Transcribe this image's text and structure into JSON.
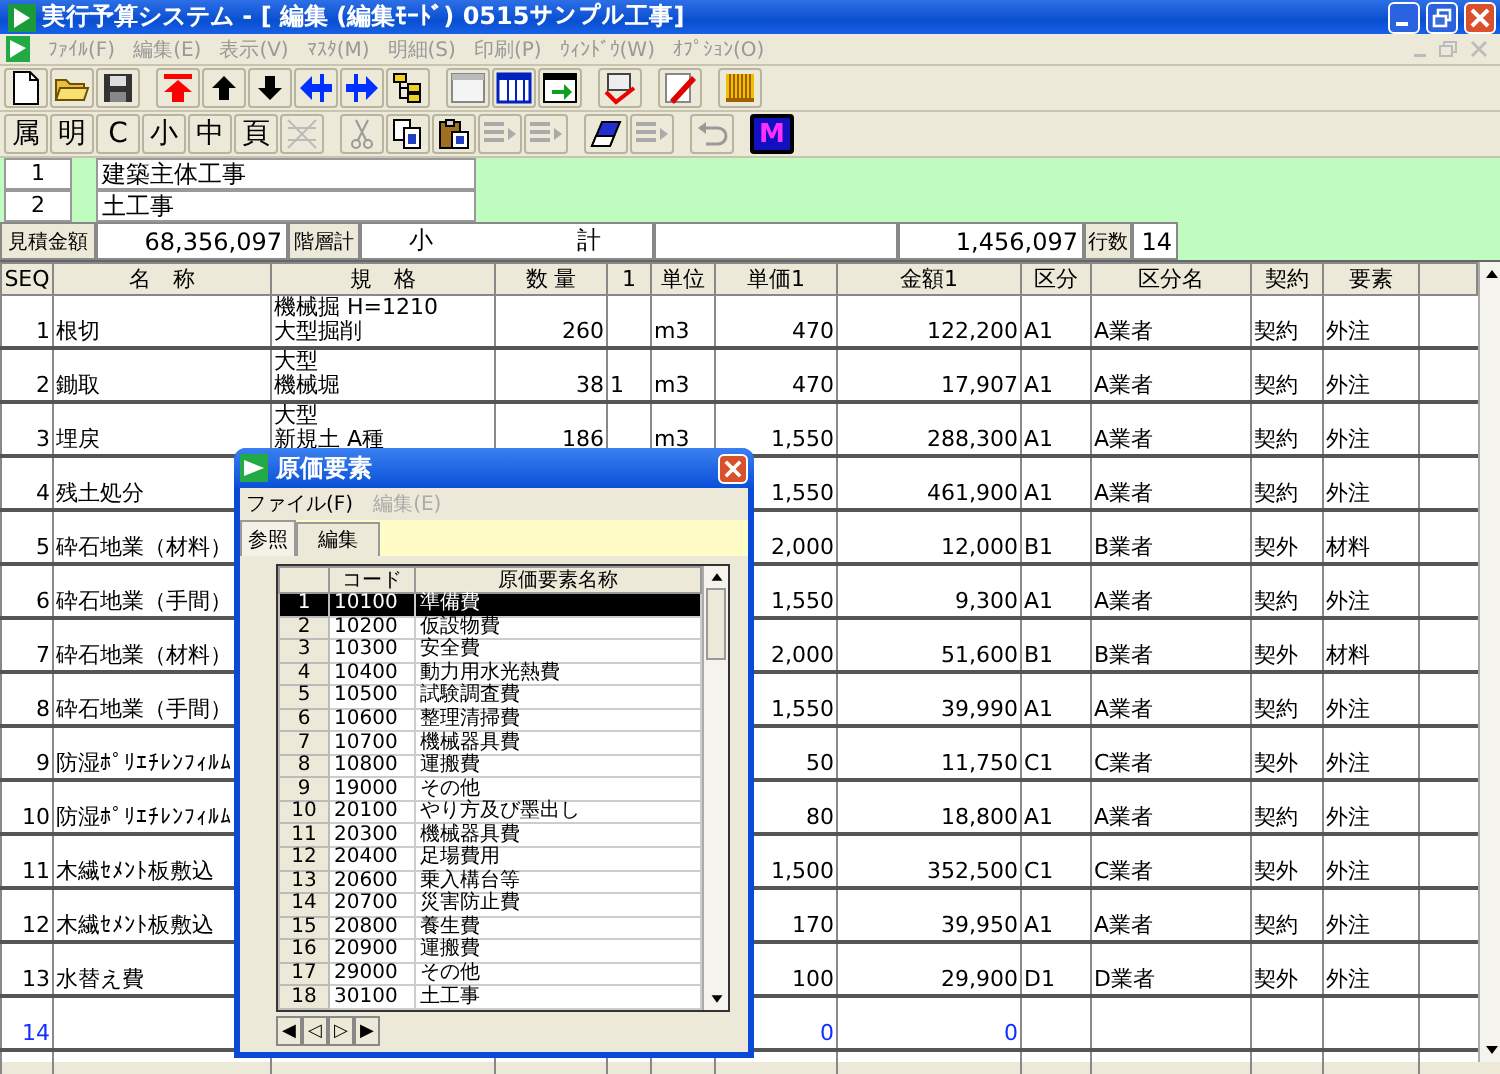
{
  "window": {
    "title": "実行予算システム - [ 編集 (編集ﾓｰﾄﾞ) 0515サンプル工事]"
  },
  "menu": [
    "ﾌｧｲﾙ(F)",
    "編集(E)",
    "表示(V)",
    "ﾏｽﾀ(M)",
    "明細(S)",
    "印刷(P)",
    "ｳｨﾝﾄﾞｳ(W)",
    "ｵﾌﾟｼｮﾝ(O)"
  ],
  "toolbar_text_buttons": [
    "属",
    "明",
    "C",
    "小",
    "中",
    "頁"
  ],
  "toolbar_m_button": "M",
  "levels": [
    {
      "no": "1",
      "name": "建築主体工事"
    },
    {
      "no": "2",
      "name": "土工事"
    }
  ],
  "summary": {
    "estimate_label": "見積金額",
    "estimate": "68,356,097",
    "level_total_label": "階層計",
    "subtotal_label": "小　　　　　　計",
    "subtotal": "1,456,097",
    "rows_label": "行数",
    "rows": "14"
  },
  "table": {
    "columns": [
      "SEQ",
      "名　称",
      "規　格",
      "数 量",
      "1",
      "単位",
      "単価1",
      "金額1",
      "区分",
      "区分名",
      "契約",
      "要素"
    ],
    "rows": [
      {
        "seq": "1",
        "name": "根切",
        "spec": [
          "機械掘 H=1210",
          "大型掘削"
        ],
        "qty": "260",
        "flag": "",
        "unit": "m3",
        "price": "470",
        "amount": "122,200",
        "cat": "A1",
        "cat_name": "A業者",
        "contract": "契約",
        "element": "外注",
        "new_row": false
      },
      {
        "seq": "2",
        "name": "鋤取",
        "spec": [
          "大型",
          "機械堀"
        ],
        "qty": "38",
        "flag": "1",
        "unit": "m3",
        "price": "470",
        "amount": "17,907",
        "cat": "A1",
        "cat_name": "A業者",
        "contract": "契約",
        "element": "外注",
        "new_row": false
      },
      {
        "seq": "3",
        "name": "埋戻",
        "spec": [
          "大型",
          "新規土 A種"
        ],
        "qty": "186",
        "flag": "",
        "unit": "m3",
        "price": "1,550",
        "amount": "288,300",
        "cat": "A1",
        "cat_name": "A業者",
        "contract": "契約",
        "element": "外注",
        "new_row": false
      },
      {
        "seq": "4",
        "name": "残土処分",
        "price": "1,550",
        "amount": "461,900",
        "cat": "A1",
        "cat_name": "A業者",
        "contract": "契約",
        "element": "外注",
        "new_row": false
      },
      {
        "seq": "5",
        "name": "砕石地業（材料）",
        "price": "2,000",
        "amount": "12,000",
        "cat": "B1",
        "cat_name": "B業者",
        "contract": "契外",
        "element": "材料",
        "new_row": false
      },
      {
        "seq": "6",
        "name": "砕石地業（手間）",
        "price": "1,550",
        "amount": "9,300",
        "cat": "A1",
        "cat_name": "A業者",
        "contract": "契約",
        "element": "外注",
        "new_row": false
      },
      {
        "seq": "7",
        "name": "砕石地業（材料）",
        "price": "2,000",
        "amount": "51,600",
        "cat": "B1",
        "cat_name": "B業者",
        "contract": "契外",
        "element": "材料",
        "new_row": false
      },
      {
        "seq": "8",
        "name": "砕石地業（手間）",
        "price": "1,550",
        "amount": "39,990",
        "cat": "A1",
        "cat_name": "A業者",
        "contract": "契約",
        "element": "外注",
        "new_row": false
      },
      {
        "seq": "9",
        "name": "防湿ﾎﾟﾘｴﾁﾚﾝﾌｨﾙﾑ",
        "price": "50",
        "amount": "11,750",
        "cat": "C1",
        "cat_name": "C業者",
        "contract": "契外",
        "element": "外注",
        "new_row": false
      },
      {
        "seq": "10",
        "name": "防湿ﾎﾟﾘｴﾁﾚﾝﾌｨﾙﾑ",
        "price": "80",
        "amount": "18,800",
        "cat": "A1",
        "cat_name": "A業者",
        "contract": "契約",
        "element": "外注",
        "new_row": false
      },
      {
        "seq": "11",
        "name": "木繊ｾﾒﾝﾄ板敷込",
        "price": "1,500",
        "amount": "352,500",
        "cat": "C1",
        "cat_name": "C業者",
        "contract": "契外",
        "element": "外注",
        "new_row": false
      },
      {
        "seq": "12",
        "name": "木繊ｾﾒﾝﾄ板敷込",
        "price": "170",
        "amount": "39,950",
        "cat": "A1",
        "cat_name": "A業者",
        "contract": "契約",
        "element": "外注",
        "new_row": false
      },
      {
        "seq": "13",
        "name": "水替え費",
        "price": "100",
        "amount": "29,900",
        "cat": "D1",
        "cat_name": "D業者",
        "contract": "契外",
        "element": "外注",
        "new_row": false
      },
      {
        "seq": "14",
        "price": "0",
        "amount": "0",
        "new_row": true
      }
    ]
  },
  "cost_dialog": {
    "title": "原価要素",
    "menu": [
      {
        "label": "ファイル(F)",
        "disabled": false
      },
      {
        "label": "編集(E)",
        "disabled": true
      }
    ],
    "tabs": [
      {
        "label": "参照",
        "selected": true
      },
      {
        "label": "編集",
        "selected": false
      }
    ],
    "columns": [
      "コード",
      "原価要素名称"
    ],
    "rows": [
      {
        "no": "1",
        "code": "10100",
        "name": "準備費",
        "selected": true
      },
      {
        "no": "2",
        "code": "10200",
        "name": "仮設物費",
        "selected": false
      },
      {
        "no": "3",
        "code": "10300",
        "name": "安全費",
        "selected": false
      },
      {
        "no": "4",
        "code": "10400",
        "name": "動力用水光熱費",
        "selected": false
      },
      {
        "no": "5",
        "code": "10500",
        "name": "試験調査費",
        "selected": false
      },
      {
        "no": "6",
        "code": "10600",
        "name": "整理清掃費",
        "selected": false
      },
      {
        "no": "7",
        "code": "10700",
        "name": "機械器具費",
        "selected": false
      },
      {
        "no": "8",
        "code": "10800",
        "name": "運搬費",
        "selected": false
      },
      {
        "no": "9",
        "code": "19000",
        "name": "その他",
        "selected": false
      },
      {
        "no": "10",
        "code": "20100",
        "name": "やり方及び墨出し",
        "selected": false
      },
      {
        "no": "11",
        "code": "20300",
        "name": "機械器具費",
        "selected": false
      },
      {
        "no": "12",
        "code": "20400",
        "name": "足場費用",
        "selected": false
      },
      {
        "no": "13",
        "code": "20600",
        "name": "乗入構台等",
        "selected": false
      },
      {
        "no": "14",
        "code": "20700",
        "name": "災害防止費",
        "selected": false
      },
      {
        "no": "15",
        "code": "20800",
        "name": "養生費",
        "selected": false
      },
      {
        "no": "16",
        "code": "20900",
        "name": "運搬費",
        "selected": false
      },
      {
        "no": "17",
        "code": "29000",
        "name": "その他",
        "selected": false
      },
      {
        "no": "18",
        "code": "30100",
        "name": "土工事",
        "selected": false
      }
    ],
    "nav": [
      "◀",
      "◁",
      "▷",
      "▶"
    ]
  }
}
